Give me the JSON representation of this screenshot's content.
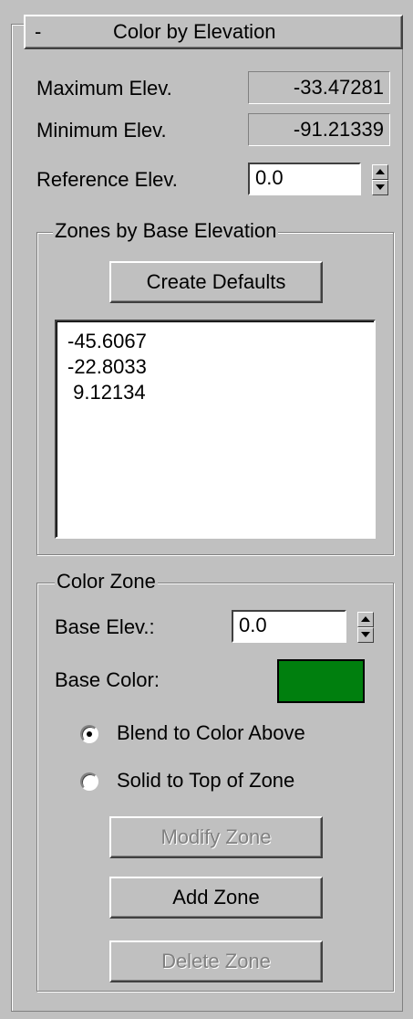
{
  "rollout": {
    "collapse_symbol": "-",
    "title": "Color by Elevation"
  },
  "elevation": {
    "max_label": "Maximum Elev.",
    "max_value": "-33.47281",
    "min_label": "Minimum Elev.",
    "min_value": "-91.21339",
    "ref_label": "Reference Elev.",
    "ref_value": "0.0"
  },
  "zones": {
    "group_label": "Zones by Base Elevation",
    "create_defaults_label": "Create Defaults",
    "items": [
      "-45.6067",
      "-22.8033",
      " 9.12134"
    ]
  },
  "color_zone": {
    "group_label": "Color Zone",
    "base_elev_label": "Base Elev.:",
    "base_elev_value": "0.0",
    "base_color_label": "Base Color:",
    "base_color": "#007f0e",
    "blend_label": "Blend to Color Above",
    "solid_label": "Solid to Top of Zone",
    "selected_mode": "blend",
    "modify_label": "Modify Zone",
    "add_label": "Add Zone",
    "delete_label": "Delete Zone"
  }
}
